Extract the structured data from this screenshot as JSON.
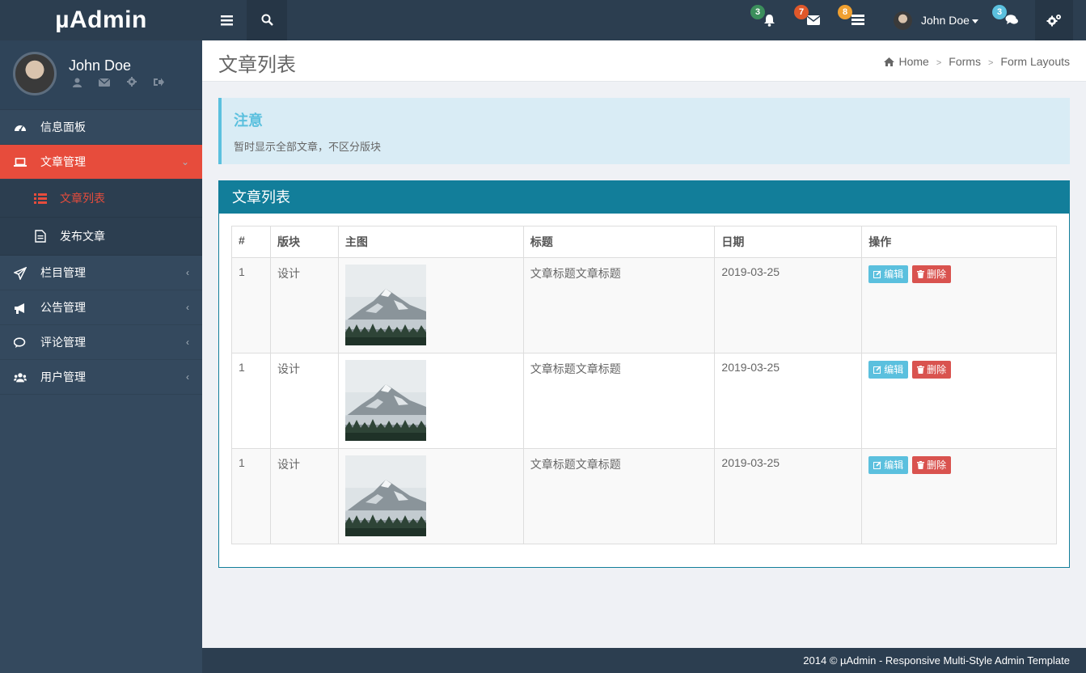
{
  "brand": "µAdmin",
  "user": {
    "name": "John Doe"
  },
  "sidebar": {
    "items": [
      {
        "label": "信息面板",
        "icon": "dashboard-icon"
      },
      {
        "label": "文章管理",
        "icon": "laptop-icon",
        "active": true,
        "children": [
          {
            "label": "文章列表",
            "icon": "list-icon",
            "active": true
          },
          {
            "label": "发布文章",
            "icon": "file-text-icon"
          }
        ]
      },
      {
        "label": "栏目管理",
        "icon": "paper-plane-icon"
      },
      {
        "label": "公告管理",
        "icon": "bullhorn-icon"
      },
      {
        "label": "评论管理",
        "icon": "comments-icon"
      },
      {
        "label": "用户管理",
        "icon": "users-icon"
      }
    ]
  },
  "topbar": {
    "notifications": {
      "count": "3",
      "color": "#3c8f5c"
    },
    "messages": {
      "count": "7",
      "color": "#e0582a"
    },
    "tasks": {
      "count": "8",
      "color": "#f0a030"
    },
    "chat": {
      "count": "3",
      "color": "#5bc0de"
    }
  },
  "page": {
    "title": "文章列表",
    "breadcrumb": [
      "Home",
      "Forms",
      "Form Layouts"
    ]
  },
  "notice": {
    "title": "注意",
    "text": "暂时显示全部文章，不区分版块"
  },
  "panel": {
    "title": "文章列表",
    "columns": [
      "#",
      "版块",
      "主图",
      "标题",
      "日期",
      "操作"
    ],
    "rows": [
      {
        "id": "1",
        "section": "设计",
        "title": "文章标题文章标题",
        "date": "2019-03-25"
      },
      {
        "id": "1",
        "section": "设计",
        "title": "文章标题文章标题",
        "date": "2019-03-25"
      },
      {
        "id": "1",
        "section": "设计",
        "title": "文章标题文章标题",
        "date": "2019-03-25"
      }
    ],
    "edit_label": "编辑",
    "delete_label": "删除"
  },
  "footer": {
    "text": "2014 © µAdmin - Responsive Multi-Style Admin Template"
  }
}
